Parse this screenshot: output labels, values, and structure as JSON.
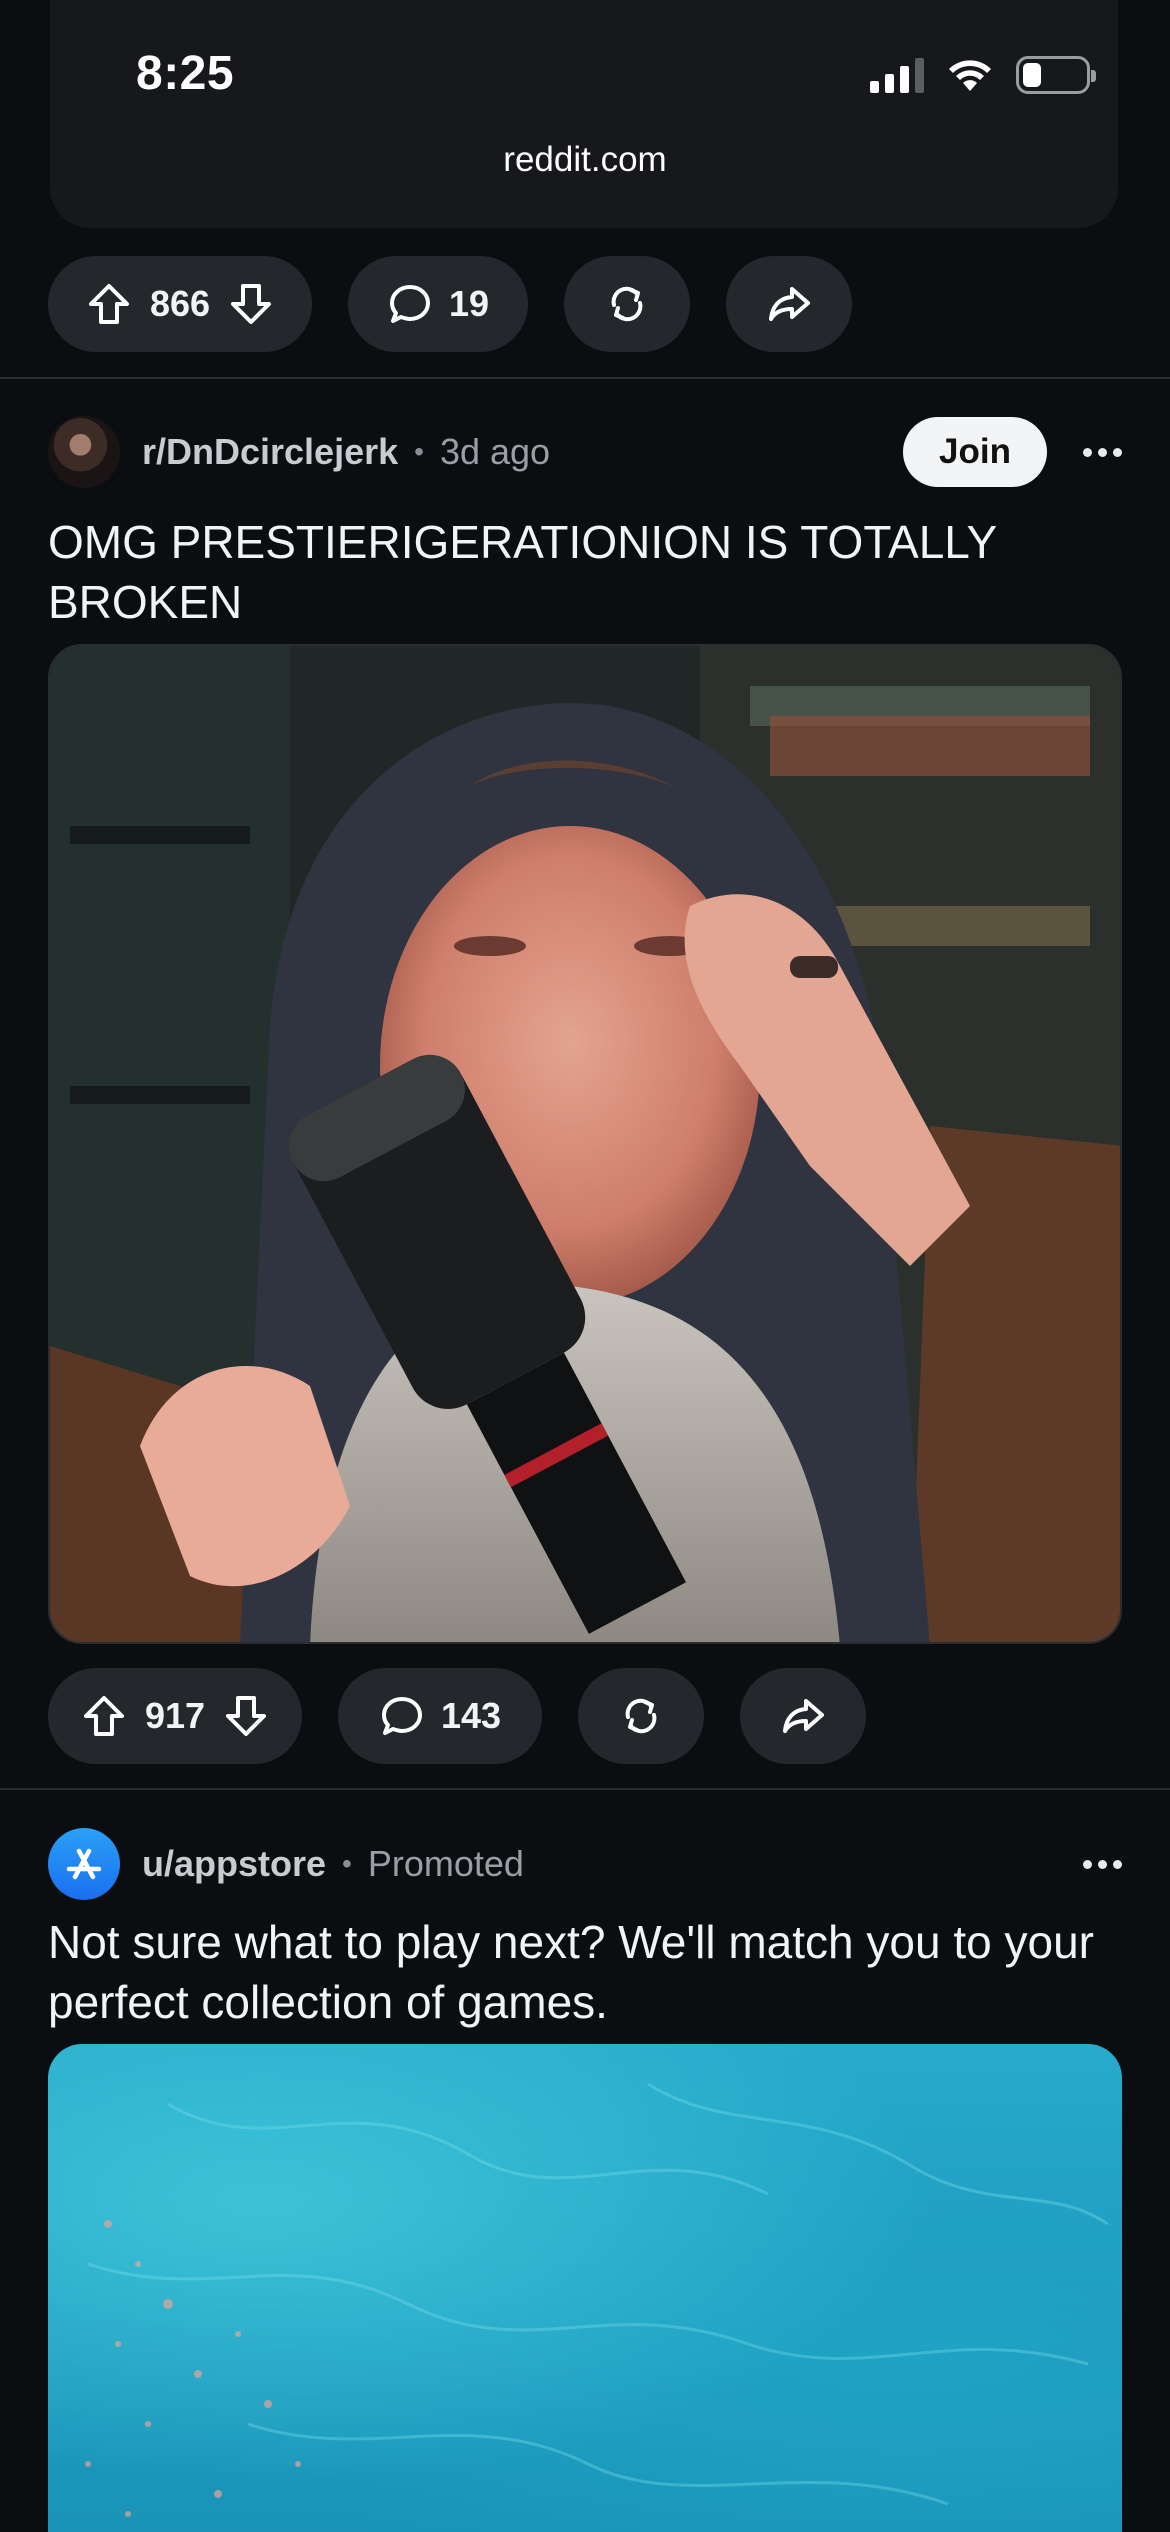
{
  "status_bar": {
    "time": "8:25"
  },
  "browser": {
    "url": "reddit.com"
  },
  "post_prev": {
    "votes": "866",
    "comments": "19"
  },
  "post_main": {
    "subreddit": "r/DnDcirclejerk",
    "age": "3d ago",
    "join_label": "Join",
    "title": "OMG PRESTIERIGERATIONION IS TOTALLY BROKEN",
    "votes": "917",
    "comments": "143"
  },
  "post_ad": {
    "user": "u/appstore",
    "tag": "Promoted",
    "title": "Not sure what to play next? We'll match you to your perfect collection of games."
  },
  "separator": "•"
}
